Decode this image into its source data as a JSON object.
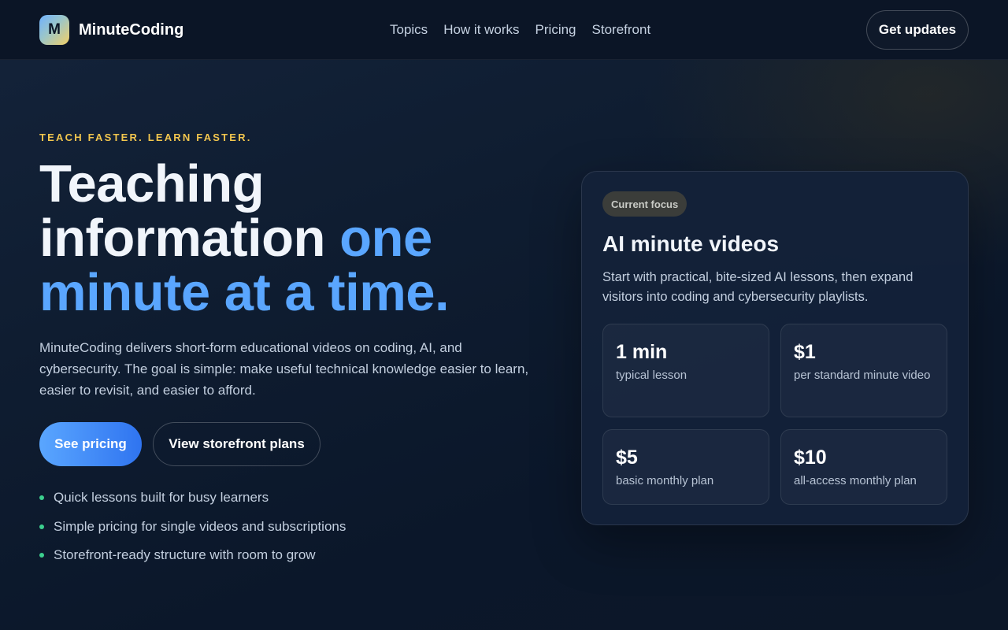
{
  "header": {
    "logo_letter": "M",
    "brand": "MinuteCoding",
    "nav": [
      "Topics",
      "How it works",
      "Pricing",
      "Storefront"
    ],
    "cta": "Get updates"
  },
  "hero": {
    "eyebrow": "TEACH FASTER. LEARN FASTER.",
    "headline_part1": "Teaching information ",
    "headline_accent": "one minute at a time.",
    "lede": "MinuteCoding delivers short-form educational videos on coding, AI, and cybersecurity. The goal is simple: make useful technical knowledge easier to learn, easier to revisit, and easier to afford.",
    "primary_cta": "See pricing",
    "secondary_cta": "View storefront plans",
    "bullets": [
      "Quick lessons built for busy learners",
      "Simple pricing for single videos and subscriptions",
      "Storefront-ready structure with room to grow"
    ]
  },
  "focus_card": {
    "pill": "Current focus",
    "title": "AI minute videos",
    "description": "Start with practical, bite-sized AI lessons, then expand visitors into coding and cybersecurity playlists.",
    "stats": [
      {
        "value": "1 min",
        "label": "typical lesson"
      },
      {
        "value": "$1",
        "label": "per standard minute video"
      },
      {
        "value": "$5",
        "label": "basic monthly plan"
      },
      {
        "value": "$10",
        "label": "all-access monthly plan"
      }
    ]
  },
  "colors": {
    "accent_blue": "#5aa6ff",
    "eyebrow_gold": "#f2c64e",
    "bullet_green": "#3ccf8e",
    "background": "#0b1628"
  }
}
